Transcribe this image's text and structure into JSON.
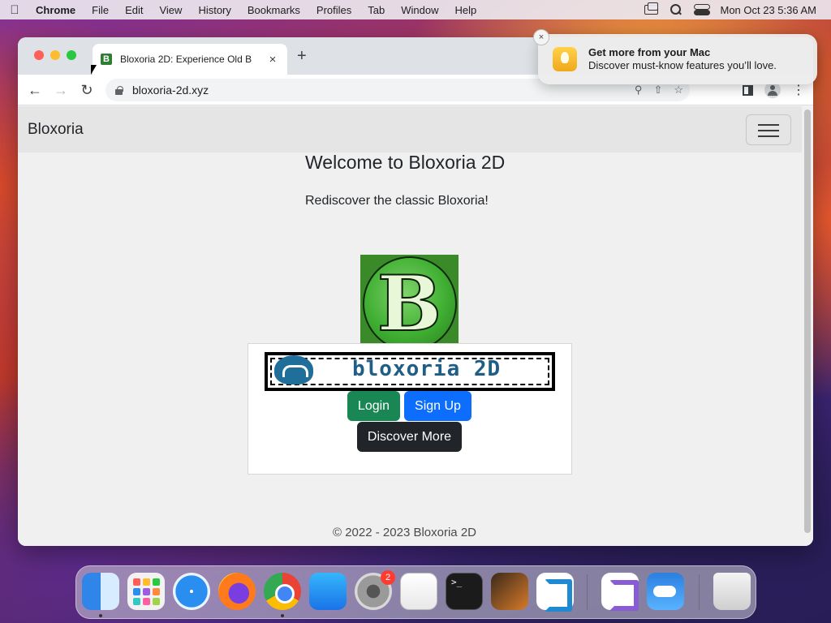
{
  "menubar": {
    "app_name": "Chrome",
    "items": [
      "File",
      "Edit",
      "View",
      "History",
      "Bookmarks",
      "Profiles",
      "Tab",
      "Window",
      "Help"
    ],
    "clock": "Mon Oct 23  5:36 AM"
  },
  "browser": {
    "tab_title": "Bloxoria 2D: Experience Old B",
    "favicon_letter": "B",
    "url": "bloxoria-2d.xyz"
  },
  "site": {
    "brand": "Bloxoria",
    "heading": "Welcome to Bloxoria 2D",
    "subtitle": "Rediscover the classic Bloxoria!",
    "logo_letter": "B",
    "banner_text": "bloxoria 2D",
    "buttons": {
      "login": "Login",
      "signup": "Sign Up",
      "discover": "Discover More"
    },
    "footer": "© 2022 - 2023 Bloxoria 2D",
    "colors": {
      "login": "#198754",
      "signup": "#0d6efd",
      "discover": "#212529"
    }
  },
  "notification": {
    "title": "Get more from your Mac",
    "body": "Discover must-know features you’ll love."
  },
  "dock": {
    "apps": [
      "finder",
      "launchpad",
      "safari",
      "firefox",
      "chrome",
      "app-store",
      "system-settings",
      "textedit",
      "terminal",
      "garageband",
      "vscode",
      "visual-studio",
      "weather",
      "trash"
    ],
    "settings_badge": "2"
  }
}
